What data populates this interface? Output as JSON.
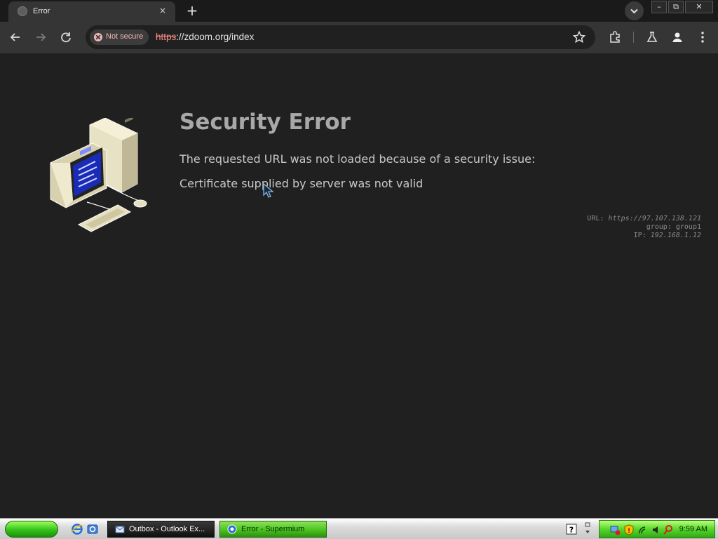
{
  "browser": {
    "tab": {
      "title": "Error",
      "close_glyph": "×"
    },
    "new_tab_glyph": "+",
    "window_controls": {
      "minimize": "–",
      "restore": "⧉",
      "close": "✕"
    },
    "security_chip": "Not secure",
    "url": {
      "scheme": "https",
      "rest": "://zdoom.org/index"
    },
    "icons": [
      "back-icon",
      "forward-icon",
      "reload-icon",
      "star-icon",
      "extensions-icon",
      "labs-flask-icon",
      "profile-icon",
      "menu-kebab-icon",
      "tab-search-icon"
    ]
  },
  "page": {
    "title": "Security Error",
    "line1": "The requested URL was not loaded because of a security issue:",
    "line2": "Certificate supplied by server was not valid",
    "meta": {
      "url_label": "URL:",
      "url_value": "https://97.107.138.121",
      "group_label": "group:",
      "group_value": "group1",
      "ip_label": "IP:",
      "ip_value": "192.168.1.12"
    }
  },
  "taskbar": {
    "tasks": [
      {
        "label": "Outbox - Outlook Ex..."
      },
      {
        "label": "Error - Supermium"
      }
    ],
    "clock": "9:59 AM",
    "colors": {
      "start": "#33c21a",
      "active_task": "#49c41f",
      "tray": "#58d629"
    }
  }
}
